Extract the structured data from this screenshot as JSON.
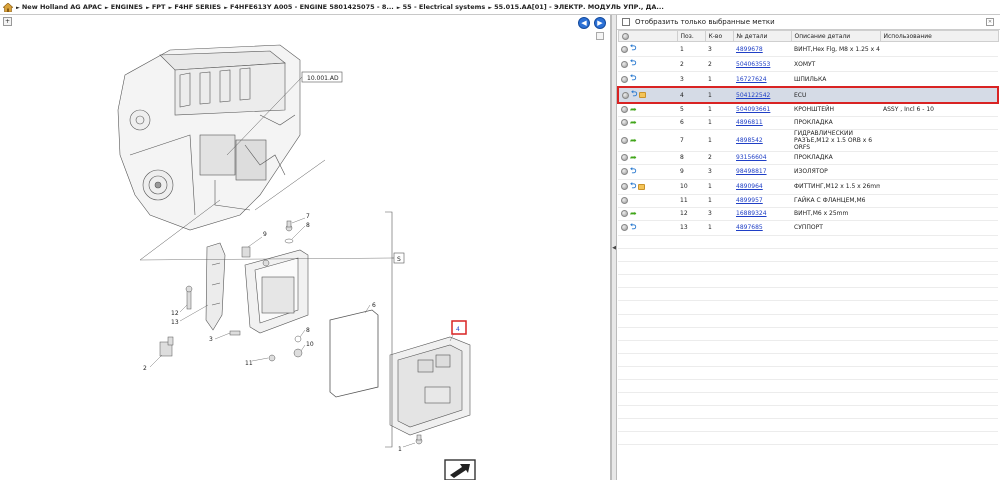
{
  "breadcrumb": [
    "New Holland AG APAC",
    "ENGINES",
    "FPT",
    "F4HF SERIES",
    "F4HFE613Y A005 - ENGINE 5801425075 - 8...",
    "55 - Electrical systems",
    "55.015.AA[01] - ЭЛЕКТР. МОДУЛЬ УПР., ДА..."
  ],
  "diagram": {
    "ref_label": "10.001.AD",
    "group_label": "S",
    "callouts": [
      "1",
      "2",
      "3",
      "4",
      "5",
      "6",
      "7",
      "8",
      "9",
      "10",
      "11",
      "12",
      "13"
    ],
    "highlighted_callout": "4"
  },
  "filter": {
    "label": "Отобразить только выбранные метки"
  },
  "table": {
    "headers": [
      "",
      "Поз.",
      "К-во",
      "№ детали",
      "Описание детали",
      "Использование"
    ],
    "rows": [
      {
        "icons": [
          "blue"
        ],
        "pos": "1",
        "qty": "3",
        "part": "4899678",
        "desc": "ВИНТ,Hex Flg, M8 x 1.25 x 45",
        "usage": ""
      },
      {
        "icons": [
          "blue"
        ],
        "pos": "2",
        "qty": "2",
        "part": "504063553",
        "desc": "ХОМУТ",
        "usage": ""
      },
      {
        "icons": [
          "blue"
        ],
        "pos": "3",
        "qty": "1",
        "part": "16727624",
        "desc": "ШПИЛЬКА",
        "usage": ""
      },
      {
        "icons": [
          "blue",
          "note"
        ],
        "pos": "4",
        "qty": "1",
        "part": "504122542",
        "desc": "ECU",
        "usage": "",
        "selected": true
      },
      {
        "icons": [
          "green"
        ],
        "pos": "5",
        "qty": "1",
        "part": "504093661",
        "desc": "КРОНШТЕЙН",
        "usage": "ASSY , Incl 6 - 10"
      },
      {
        "icons": [
          "green"
        ],
        "pos": "6",
        "qty": "1",
        "part": "4896811",
        "desc": "ПРОКЛАДКА",
        "usage": ""
      },
      {
        "icons": [
          "green"
        ],
        "pos": "7",
        "qty": "1",
        "part": "4898542",
        "desc": "ГИДРАВЛИЧЕСКИЙ РАЗЪЕ,M12 x 1.5 ORB x 6 ORFS",
        "usage": "",
        "tall": true
      },
      {
        "icons": [
          "green"
        ],
        "pos": "8",
        "qty": "2",
        "part": "93156604",
        "desc": "ПРОКЛАДКА",
        "usage": ""
      },
      {
        "icons": [
          "blue"
        ],
        "pos": "9",
        "qty": "3",
        "part": "98498817",
        "desc": "ИЗОЛЯТОР",
        "usage": ""
      },
      {
        "icons": [
          "blue",
          "note"
        ],
        "pos": "10",
        "qty": "1",
        "part": "4890964",
        "desc": "ФИТТИНГ,M12 x 1.5 x 26mm L",
        "usage": ""
      },
      {
        "icons": [],
        "pos": "11",
        "qty": "1",
        "part": "4899957",
        "desc": "ГАЙКА С ФЛАНЦЕМ,M6",
        "usage": ""
      },
      {
        "icons": [
          "green"
        ],
        "pos": "12",
        "qty": "3",
        "part": "16889324",
        "desc": "ВИНТ,M6 x 25mm",
        "usage": ""
      },
      {
        "icons": [
          "blue"
        ],
        "pos": "13",
        "qty": "1",
        "part": "4897685",
        "desc": "СУППОРТ",
        "usage": ""
      }
    ],
    "empty_rows": 16
  },
  "colors": {
    "selection_border": "#d92323",
    "selection_fill": "#d5dbe6",
    "link": "#1f3fc6",
    "nav_button": "#2b70d6"
  }
}
